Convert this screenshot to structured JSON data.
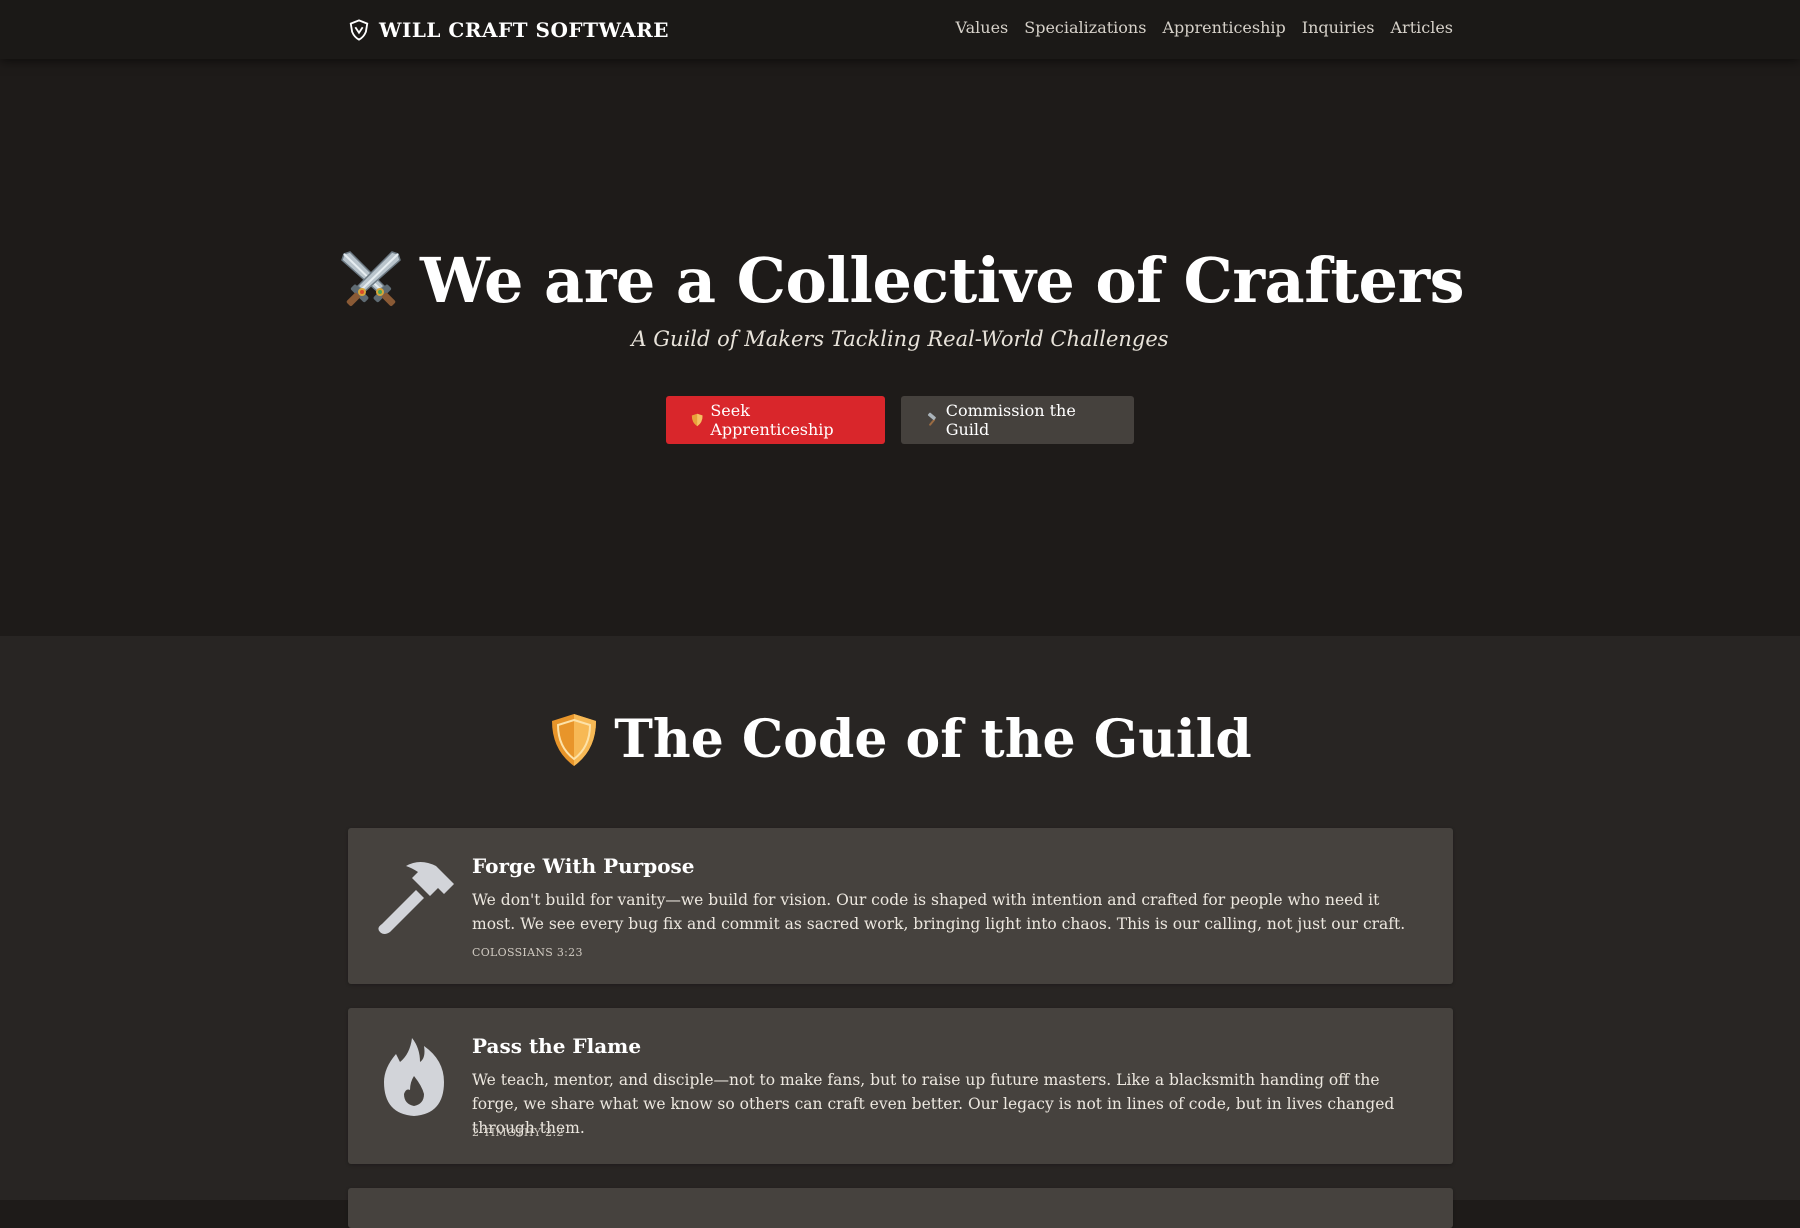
{
  "header": {
    "brand": "WILL CRAFT SOFTWARE",
    "brand_icon": "shield-crest-icon",
    "nav": [
      "Values",
      "Specializations",
      "Apprenticeship",
      "Inquiries",
      "Articles"
    ]
  },
  "hero": {
    "icon": "crossed-swords-icon",
    "title": "We are a Collective of Crafters",
    "subtitle": "A Guild of Makers Tackling Real-World Challenges",
    "primary_button": {
      "icon": "shield-icon",
      "label": "Seek Apprenticeship",
      "color": "#d9262b"
    },
    "secondary_button": {
      "icon": "hammer-icon",
      "label": "Commission the Guild",
      "color": "#45413d"
    }
  },
  "code": {
    "icon": "shield-icon",
    "title": "The Code of the Guild",
    "cards": [
      {
        "icon": "hammer-icon",
        "title": "Forge With Purpose",
        "body": "We don't build for vanity—we build for vision. Our code is shaped with intention and crafted for people who need it most. We see every bug fix and commit as sacred work, bringing light into chaos. This is our calling, not just our craft.",
        "reference": "COLOSSIANS 3:23"
      },
      {
        "icon": "flame-icon",
        "title": "Pass the Flame",
        "body": "We teach, mentor, and disciple—not to make fans, but to raise up future masters. Like a blacksmith handing off the forge, we share what we know so others can craft even better. Our legacy is not in lines of code, but in lives changed through them.",
        "reference": "2 TIMOTHY 2:2"
      }
    ]
  },
  "colors": {
    "background": "#1e1b19",
    "section": "#282523",
    "card": "#46423e",
    "accent": "#d9262b"
  }
}
